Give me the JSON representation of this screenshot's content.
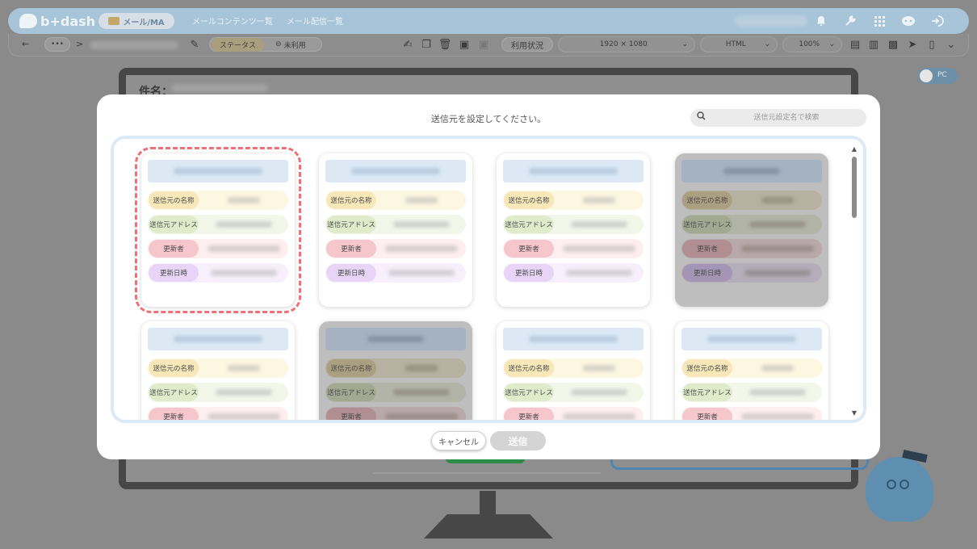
{
  "nav": {
    "logo": "b+dash",
    "active_menu": "メール/MA",
    "links": [
      "メールコンテンツ一覧",
      "メール配信一覧"
    ]
  },
  "toolbar": {
    "back": "←",
    "more": "•••",
    "sep": ">",
    "status_label": "ステータス",
    "status_value": "未利用",
    "usage_button": "利用状況",
    "resolution": "1920 × 1080",
    "format": "HTML",
    "zoom": "100%"
  },
  "background": {
    "subject_label": "件名：",
    "device_toggle": "PC"
  },
  "modal": {
    "title": "送信元を設定してください。",
    "search_placeholder": "送信元設定名で検索",
    "field_labels": {
      "name": "送信元の名称",
      "address": "送信元アドレス",
      "updater": "更新者",
      "updated_at": "更新日時"
    },
    "cancel": "キャンセル",
    "send": "送信",
    "cards": [
      {
        "disabled": false,
        "selected": true
      },
      {
        "disabled": false,
        "selected": false
      },
      {
        "disabled": false,
        "selected": false
      },
      {
        "disabled": true,
        "selected": false
      },
      {
        "disabled": false,
        "selected": false
      },
      {
        "disabled": true,
        "selected": false
      },
      {
        "disabled": false,
        "selected": false
      },
      {
        "disabled": false,
        "selected": false
      }
    ]
  },
  "colors": {
    "nav_bg": "#a7c4d8",
    "selected_outline": "#ef6f78",
    "panel_border": "#dceaf5"
  }
}
